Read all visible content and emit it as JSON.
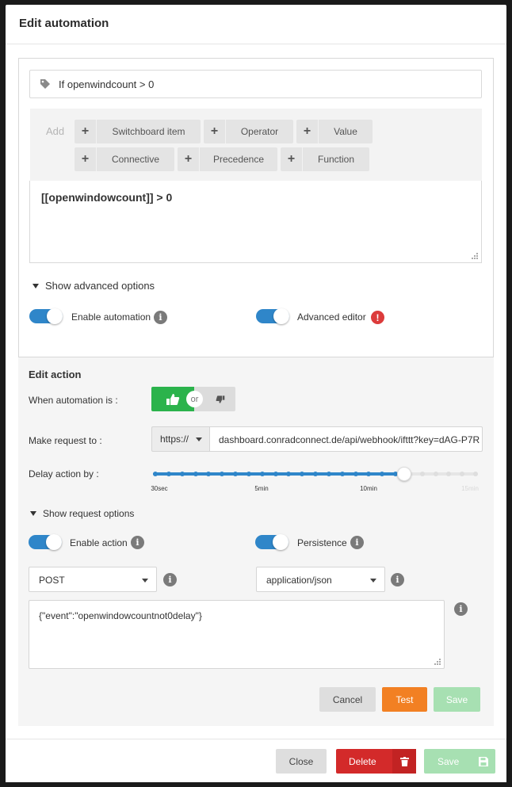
{
  "modal": {
    "title": "Edit automation"
  },
  "condition": {
    "tag_value": "If openwindcount > 0",
    "add_label": "Add",
    "builder_buttons": [
      "Switchboard item",
      "Operator",
      "Value",
      "Connective",
      "Precedence",
      "Function"
    ],
    "expression": "[[openwindowcount]] > 0",
    "advanced_toggle_label": "Show advanced options",
    "enable_automation_label": "Enable automation",
    "enable_automation_on": true,
    "advanced_editor_label": "Advanced editor",
    "advanced_editor_on": true
  },
  "action": {
    "title": "Edit action",
    "when_label": "When automation is :",
    "or_label": "or",
    "request_label": "Make request to :",
    "scheme": "https://",
    "url": "dashboard.conradconnect.de/api/webhook/ifttt?key=dAG-P7R",
    "delay_label": "Delay action by :",
    "delay_ticks": [
      "30sec",
      "5min",
      "10min",
      "15min"
    ],
    "delay_selected_fraction": 0.77,
    "request_options_label": "Show request options",
    "enable_action_label": "Enable action",
    "enable_action_on": true,
    "persistence_label": "Persistence",
    "persistence_on": true,
    "method": "POST",
    "content_type": "application/json",
    "body": "{\"event\":\"openwindowcountnot0delay\"}",
    "cancel_label": "Cancel",
    "test_label": "Test",
    "save_label": "Save"
  },
  "footer": {
    "close_label": "Close",
    "delete_label": "Delete",
    "save_label": "Save"
  },
  "colors": {
    "accent_blue": "#2f86c9",
    "thumb_green": "#2bb34c",
    "test_orange": "#f28023",
    "delete_red": "#d32a2a",
    "save_disabled_green": "#a7e0b2",
    "warning_red": "#dc3b3b"
  },
  "icons": [
    "tag-icon",
    "plus-icon",
    "info-icon",
    "warning-icon",
    "thumbs-up-icon",
    "thumbs-down-icon",
    "trash-icon",
    "floppy-disk-icon",
    "chevron-down-icon",
    "resize-grip-icon"
  ]
}
